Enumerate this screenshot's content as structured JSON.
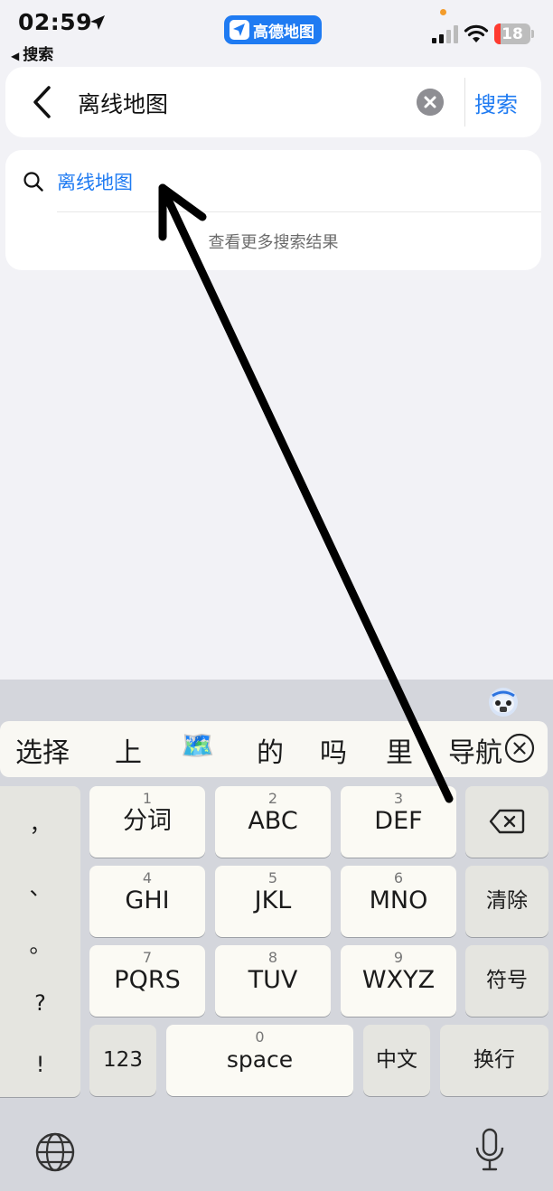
{
  "status_bar": {
    "time": "02:59",
    "back_app": "搜索",
    "app_pill": "高德地图",
    "battery": "18",
    "battery_level": 0.18,
    "colors": {
      "battery_low": "#ff3b30",
      "recording_dot": "#f39c2b"
    },
    "icons": [
      "location-arrow-icon",
      "signal-icon",
      "wifi-icon",
      "battery-icon"
    ]
  },
  "search": {
    "query": "离线地图",
    "search_label": "搜索",
    "accent": "#1f7bf2"
  },
  "suggestions": {
    "items": [
      {
        "text": "离线地图",
        "icon": "search-icon"
      }
    ],
    "more": "查看更多搜索结果"
  },
  "keyboard": {
    "candidates": [
      "选择",
      "上",
      "🗺️",
      "的",
      "吗",
      "里",
      "导航"
    ],
    "punctuation": [
      "，",
      "、",
      "。",
      "?",
      "!"
    ],
    "keys": [
      {
        "num": "1",
        "label": "分词"
      },
      {
        "num": "2",
        "label": "ABC"
      },
      {
        "num": "3",
        "label": "DEF"
      },
      {
        "num": "4",
        "label": "GHI"
      },
      {
        "num": "5",
        "label": "JKL"
      },
      {
        "num": "6",
        "label": "MNO"
      },
      {
        "num": "7",
        "label": "PQRS"
      },
      {
        "num": "8",
        "label": "TUV"
      },
      {
        "num": "9",
        "label": "WXYZ"
      }
    ],
    "clear": "清除",
    "symbols": "符号",
    "numbers": "123",
    "space_num": "0",
    "space": "space",
    "chinese": "中文",
    "newline": "换行"
  }
}
